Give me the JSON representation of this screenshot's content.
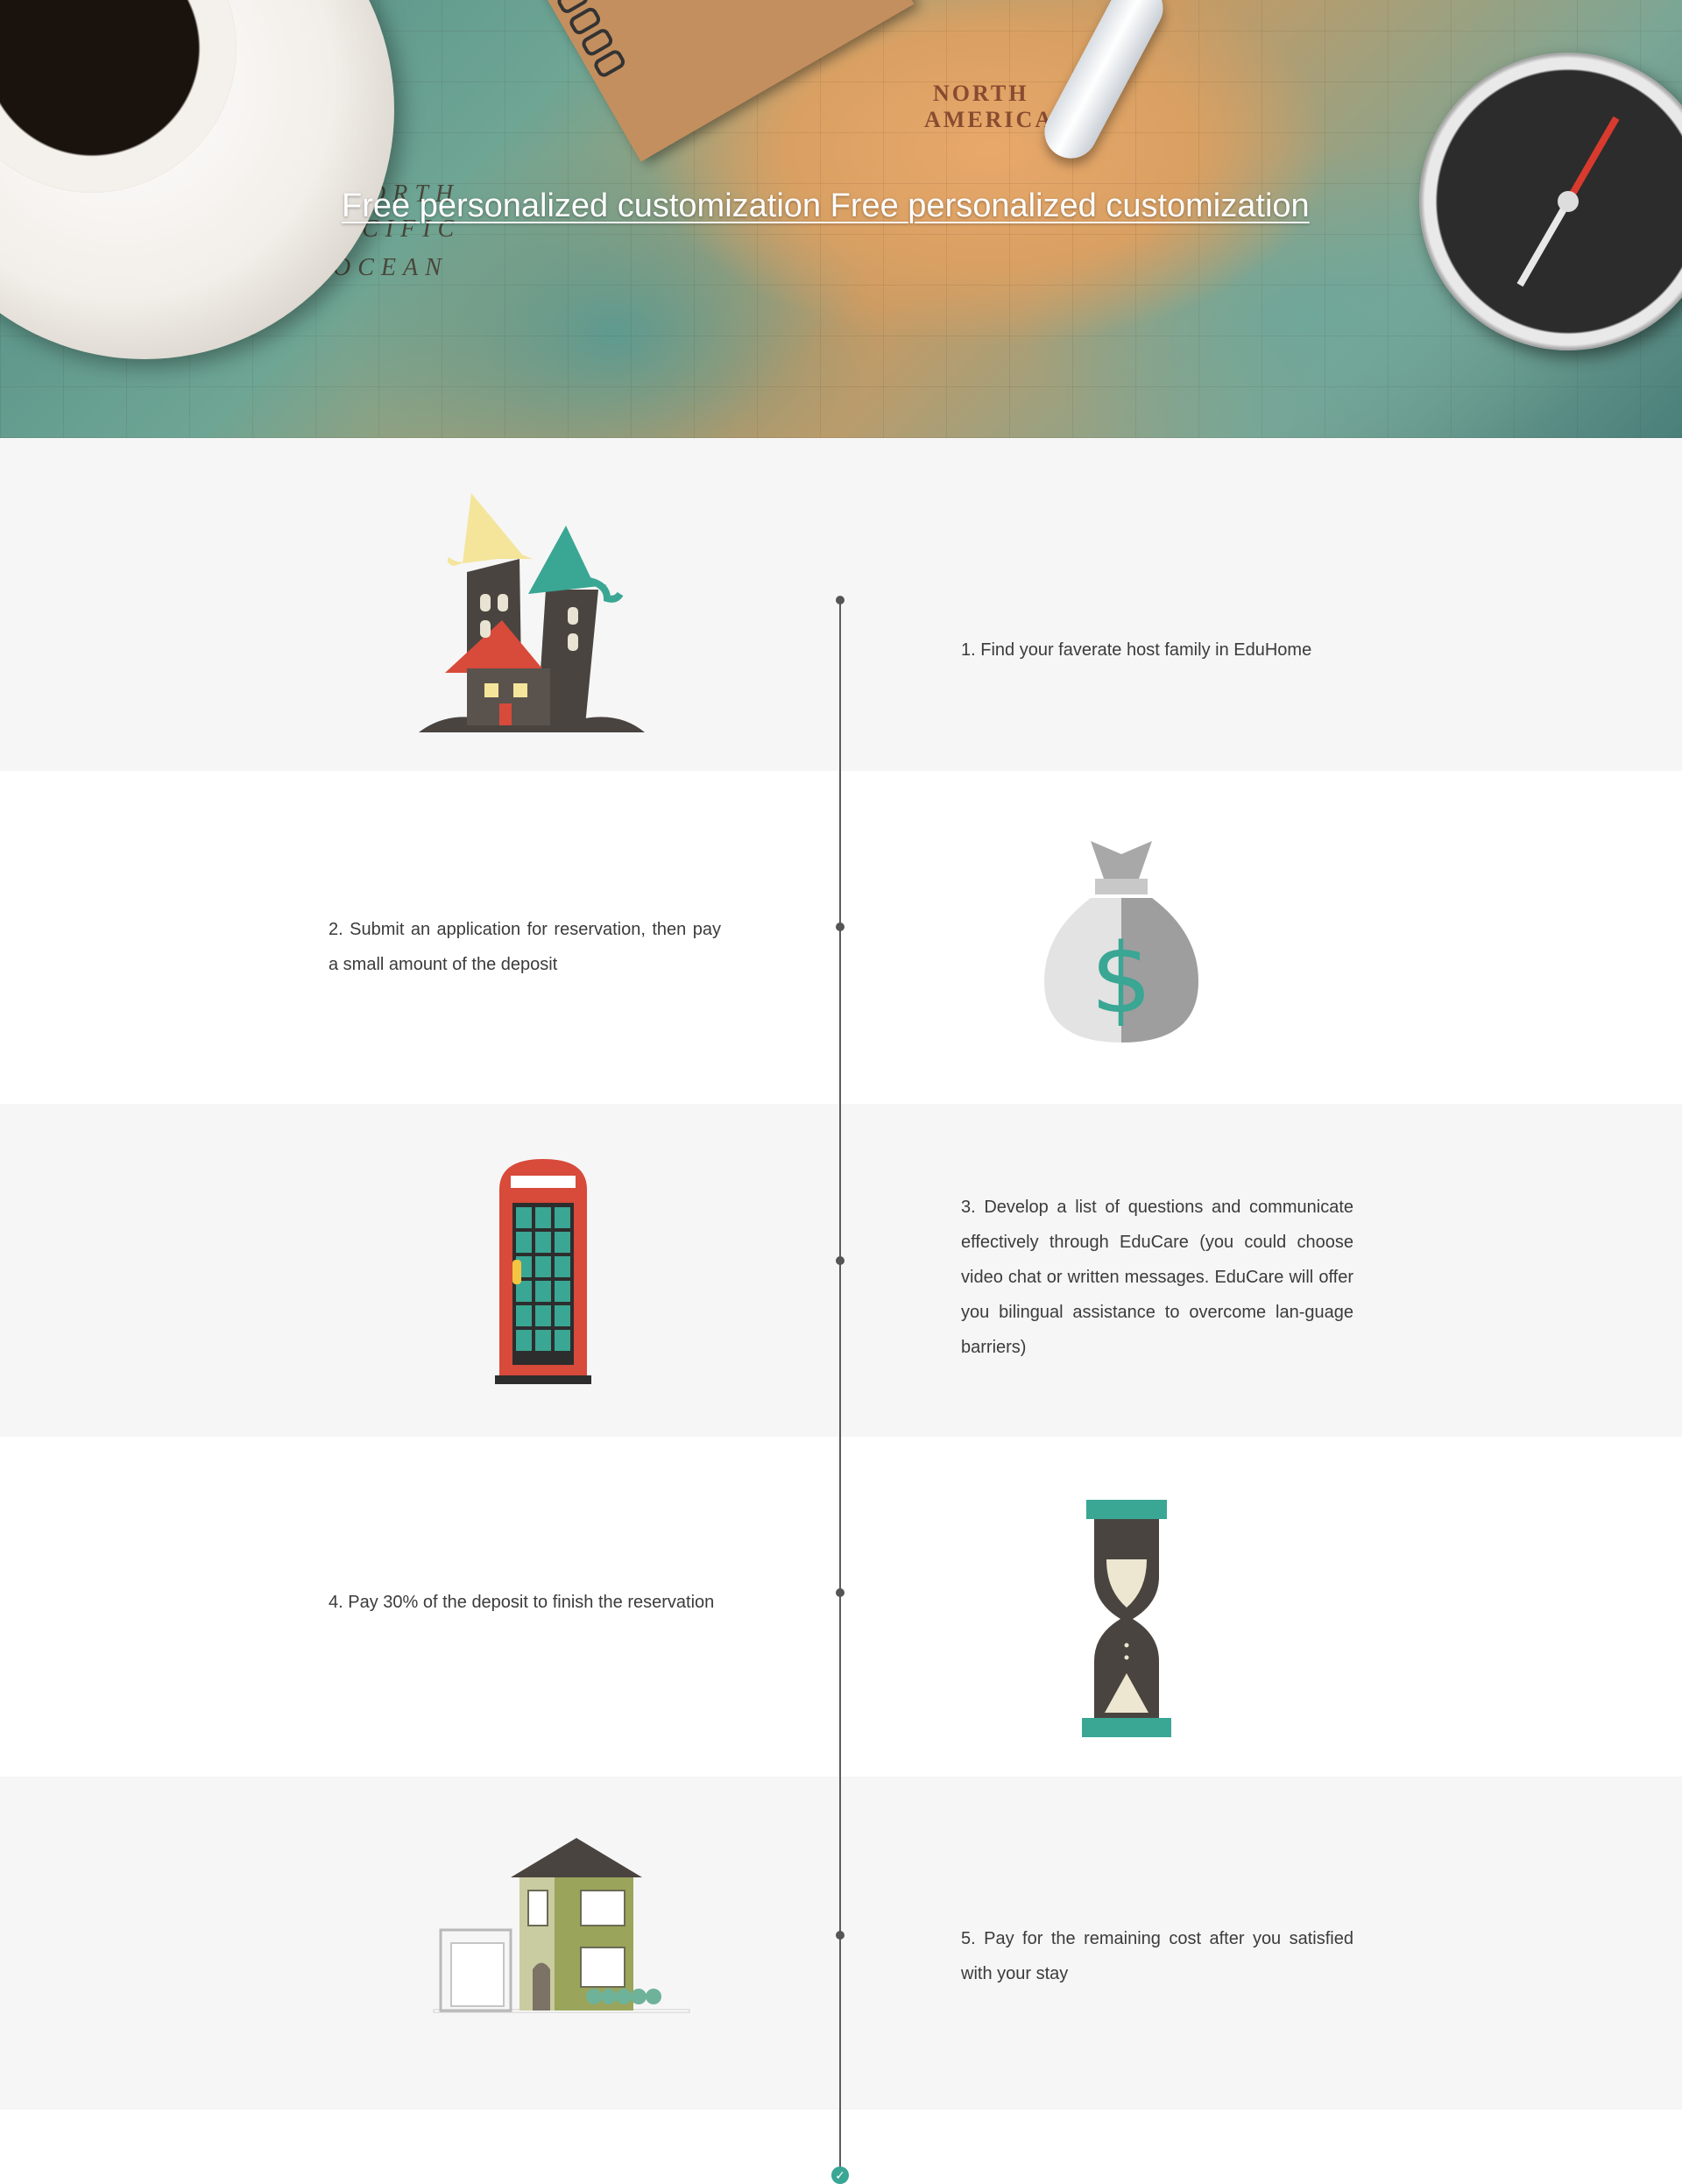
{
  "hero": {
    "title": "Free personalized customization  Free personalized customization",
    "map_labels": [
      "NORTH",
      "AMERICA",
      "ORTH",
      "ACIFIC",
      "OCEAN"
    ]
  },
  "steps": [
    {
      "number": 1,
      "text": "1. Find your faverate host family in EduHome",
      "icon": "castle-house-icon"
    },
    {
      "number": 2,
      "text": "2. Submit an application for reservation, then pay a small amount of the deposit",
      "icon": "money-bag-icon"
    },
    {
      "number": 3,
      "text": "3. Develop a list of questions and communicate effectively through EduCare (you could choose video chat or written messages. EduCare will offer you bilingual assistance to overcome lan-guage barriers)",
      "icon": "phone-booth-icon"
    },
    {
      "number": 4,
      "text": "4.  Pay 30% of the deposit to finish the reservation",
      "icon": "hourglass-icon"
    },
    {
      "number": 5,
      "text": "5. Pay for the remaining cost after you satisfied with your stay",
      "icon": "house-icon"
    }
  ],
  "icons": {
    "money_symbol": "$",
    "check": "✓"
  },
  "colors": {
    "accent": "#3aa694",
    "band_grey": "#f6f6f6",
    "text": "#3b3b3b",
    "timeline": "#5b5b5b",
    "red": "#d84a3a",
    "dark_brown": "#4a4440",
    "yellow": "#f4e59b"
  }
}
